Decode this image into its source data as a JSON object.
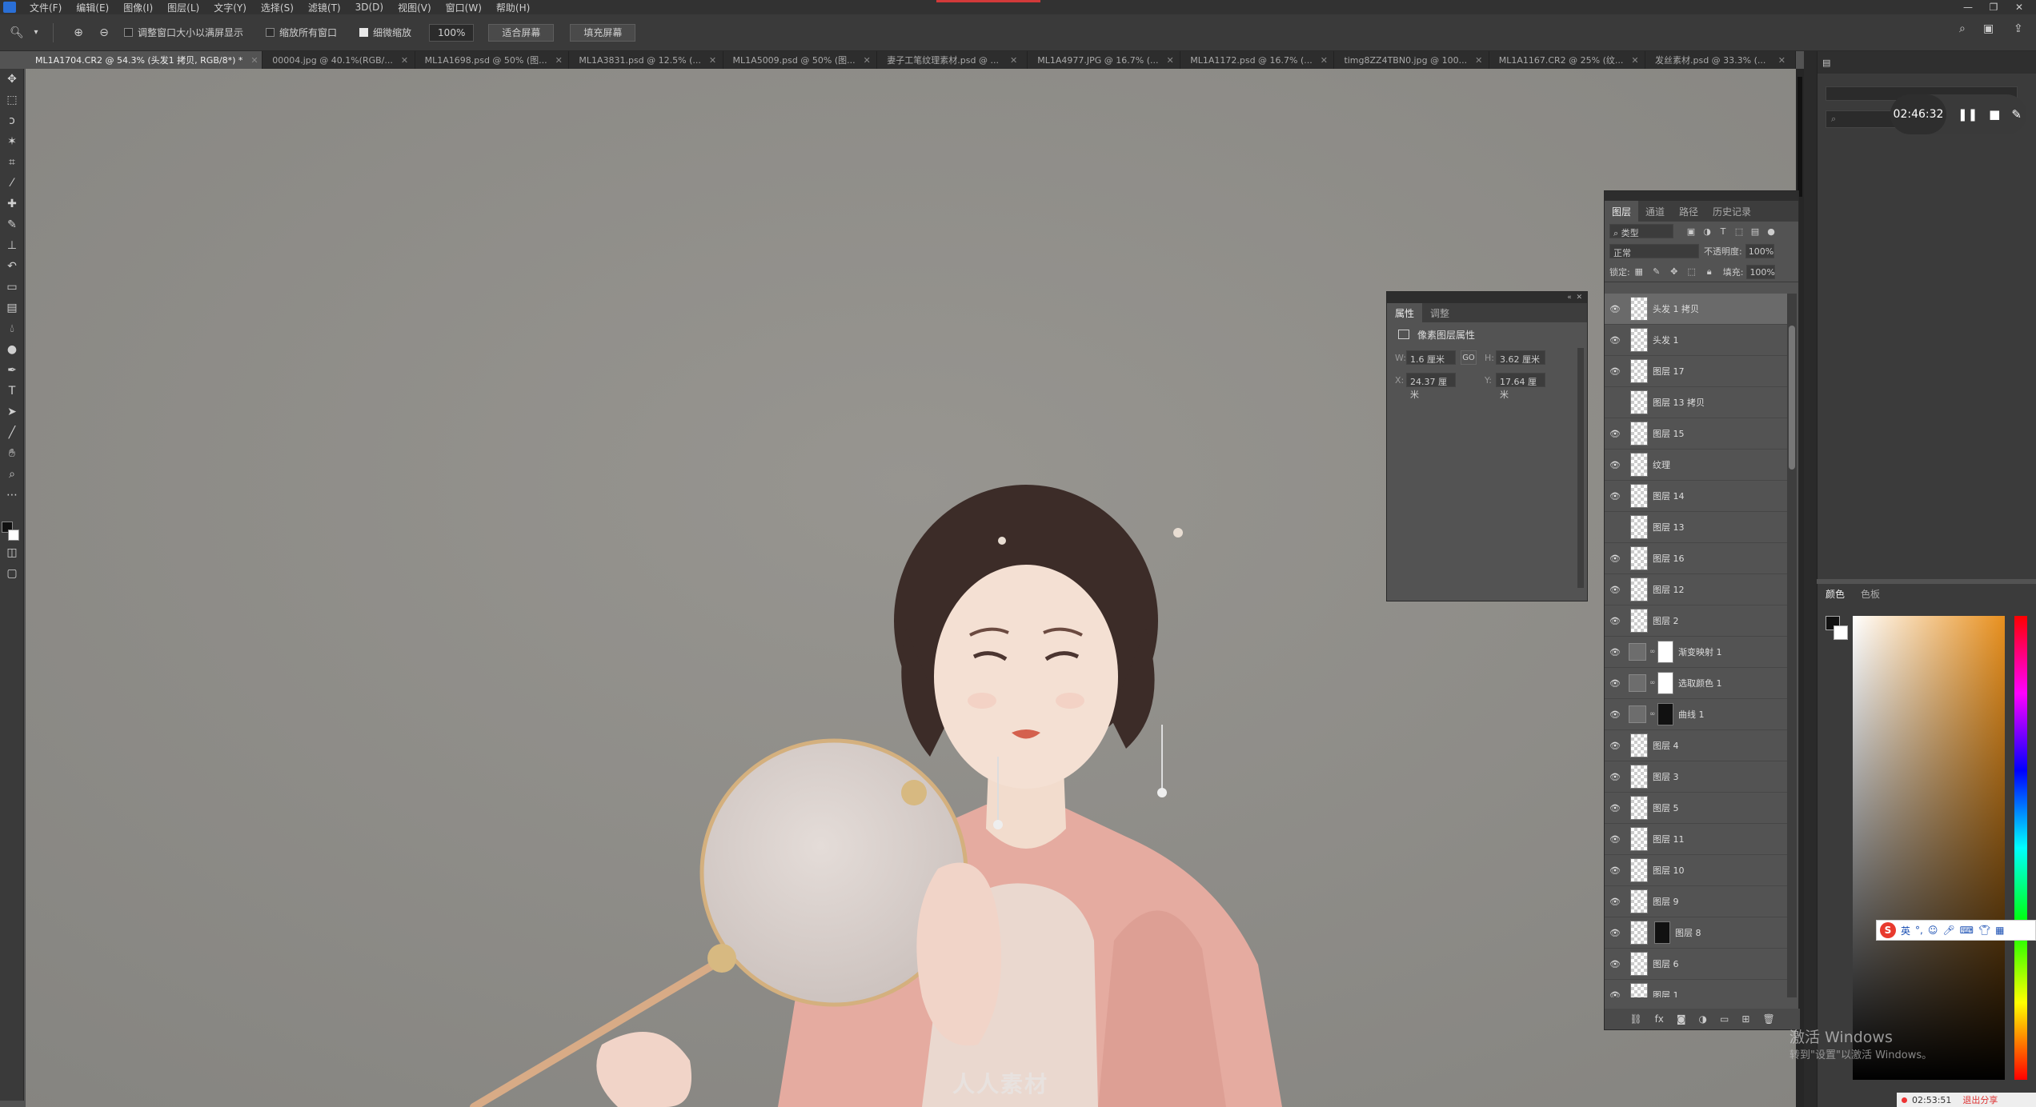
{
  "menubar": {
    "items": [
      "文件(F)",
      "编辑(E)",
      "图像(I)",
      "图层(L)",
      "文字(Y)",
      "选择(S)",
      "滤镜(T)",
      "3D(D)",
      "视图(V)",
      "窗口(W)",
      "帮助(H)"
    ]
  },
  "options": {
    "resize_windows_label": "调整窗口大小以满屏显示",
    "zoom_all_label": "缩放所有窗口",
    "scrubby_zoom_label": "细微缩放",
    "zoom_value": "100%",
    "fit_screen_label": "适合屏幕",
    "fill_screen_label": "填充屏幕"
  },
  "tabs": [
    {
      "label": "ML1A1704.CR2 @ 54.3% (头发1 拷贝, RGB/8*) *",
      "active": true
    },
    {
      "label": "00004.jpg @ 40.1%(RGB/..."
    },
    {
      "label": "ML1A1698.psd @ 50% (图..."
    },
    {
      "label": "ML1A3831.psd @ 12.5% (..."
    },
    {
      "label": "ML1A5009.psd @ 50% (图..."
    },
    {
      "label": "妻子工笔纹理素材.psd @ ..."
    },
    {
      "label": "ML1A4977.JPG @ 16.7% (..."
    },
    {
      "label": "ML1A1172.psd @ 16.7% (..."
    },
    {
      "label": "timg8ZZ4TBN0.jpg @ 100..."
    },
    {
      "label": "ML1A1167.CR2 @ 25% (纹..."
    },
    {
      "label": "发丝素材.psd @ 33.3% (..."
    }
  ],
  "timer": {
    "time": "02:46:32"
  },
  "properties": {
    "tab_properties": "属性",
    "tab_adjustments": "调整",
    "title": "像素图层属性",
    "w_label": "W:",
    "w_value": "1.6 厘米",
    "h_label": "H:",
    "h_value": "3.62 厘米",
    "x_label": "X:",
    "x_value": "24.37 厘米",
    "y_label": "Y:",
    "y_value": "17.64 厘米",
    "link_icon": "GO"
  },
  "layers": {
    "tabs": [
      "图层",
      "通道",
      "路径",
      "历史记录"
    ],
    "filter_label": "类型",
    "blend_mode": "正常",
    "opacity_label": "不透明度:",
    "opacity_value": "100%",
    "lock_label": "锁定:",
    "fill_label": "填充:",
    "fill_value": "100%",
    "items": [
      {
        "name": "头发 1 拷贝",
        "visible": true,
        "selected": true,
        "kind": "pixel"
      },
      {
        "name": "头发 1",
        "visible": true,
        "kind": "pixel"
      },
      {
        "name": "图层 17",
        "visible": true,
        "kind": "pixel"
      },
      {
        "name": "图层 13 拷贝",
        "visible": false,
        "kind": "pixel"
      },
      {
        "name": "图层 15",
        "visible": true,
        "kind": "pixel"
      },
      {
        "name": "纹理",
        "visible": true,
        "kind": "pixel"
      },
      {
        "name": "图层 14",
        "visible": true,
        "kind": "pixel"
      },
      {
        "name": "图层 13",
        "visible": false,
        "kind": "pixel"
      },
      {
        "name": "图层 16",
        "visible": true,
        "kind": "pixel"
      },
      {
        "name": "图层 12",
        "visible": true,
        "kind": "pixel"
      },
      {
        "name": "图层 2",
        "visible": true,
        "kind": "pixel"
      },
      {
        "name": "渐变映射 1",
        "visible": true,
        "kind": "adjustment"
      },
      {
        "name": "选取颜色 1",
        "visible": true,
        "kind": "adjustment"
      },
      {
        "name": "曲线 1",
        "visible": true,
        "kind": "adjustment-dark"
      },
      {
        "name": "图层 4",
        "visible": true,
        "kind": "pixel"
      },
      {
        "name": "图层 3",
        "visible": true,
        "kind": "pixel"
      },
      {
        "name": "图层 5",
        "visible": true,
        "kind": "pixel"
      },
      {
        "name": "图层 11",
        "visible": true,
        "kind": "pixel"
      },
      {
        "name": "图层 10",
        "visible": true,
        "kind": "pixel"
      },
      {
        "name": "图层 9",
        "visible": true,
        "kind": "pixel"
      },
      {
        "name": "图层 8",
        "visible": true,
        "kind": "pixel-mask"
      },
      {
        "name": "图层 6",
        "visible": true,
        "kind": "pixel"
      },
      {
        "name": "图层 1",
        "visible": true,
        "kind": "pixel"
      }
    ]
  },
  "color": {
    "tab_color": "颜色",
    "tab_swatches": "色板",
    "fg": "#111111",
    "bg": "#ffffff",
    "hue": "#e8901e"
  },
  "ime": {
    "label": "英"
  },
  "system": {
    "activate_title": "激活 Windows",
    "activate_sub": "转到\"设置\"以激活 Windows。",
    "status_time": "02:53:51",
    "status_exit": "退出分享"
  },
  "watermark": "人人素材"
}
